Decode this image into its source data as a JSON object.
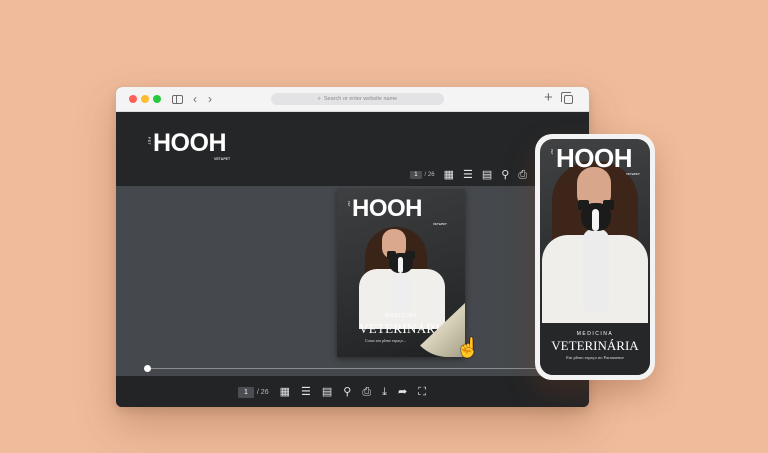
{
  "browser": {
    "address_placeholder": "Search or enter website name",
    "icons": [
      "sidebar-toggle-icon",
      "back-icon",
      "forward-icon",
      "new-tab-icon",
      "tabs-overview-icon"
    ]
  },
  "viewer": {
    "logo": "HOOH",
    "logo_side": "PET",
    "logo_sub": "VET&PET",
    "pager": {
      "current": "1",
      "total": "/ 26"
    },
    "toolbar_icons": [
      "thumbnails-icon",
      "table-of-contents-icon",
      "chapters-icon",
      "search-icon",
      "print-icon",
      "download-icon",
      "share-icon",
      "fullscreen-icon"
    ],
    "progress": 0.0
  },
  "cover": {
    "logo": "HOOH",
    "logo_side": "PET",
    "logo_sub": "VET&PET",
    "kicker": "MEDICINA",
    "title": "VETERINÁRIA",
    "tagline": "Como seu pleno espaço..."
  },
  "phone": {
    "logo": "HOOH",
    "logo_side": "PET",
    "logo_sub": "VET&PET",
    "kicker": "MEDICINA",
    "title": "VETERINÁRIA",
    "tagline": "Em pleno espaço no Paranaense"
  }
}
